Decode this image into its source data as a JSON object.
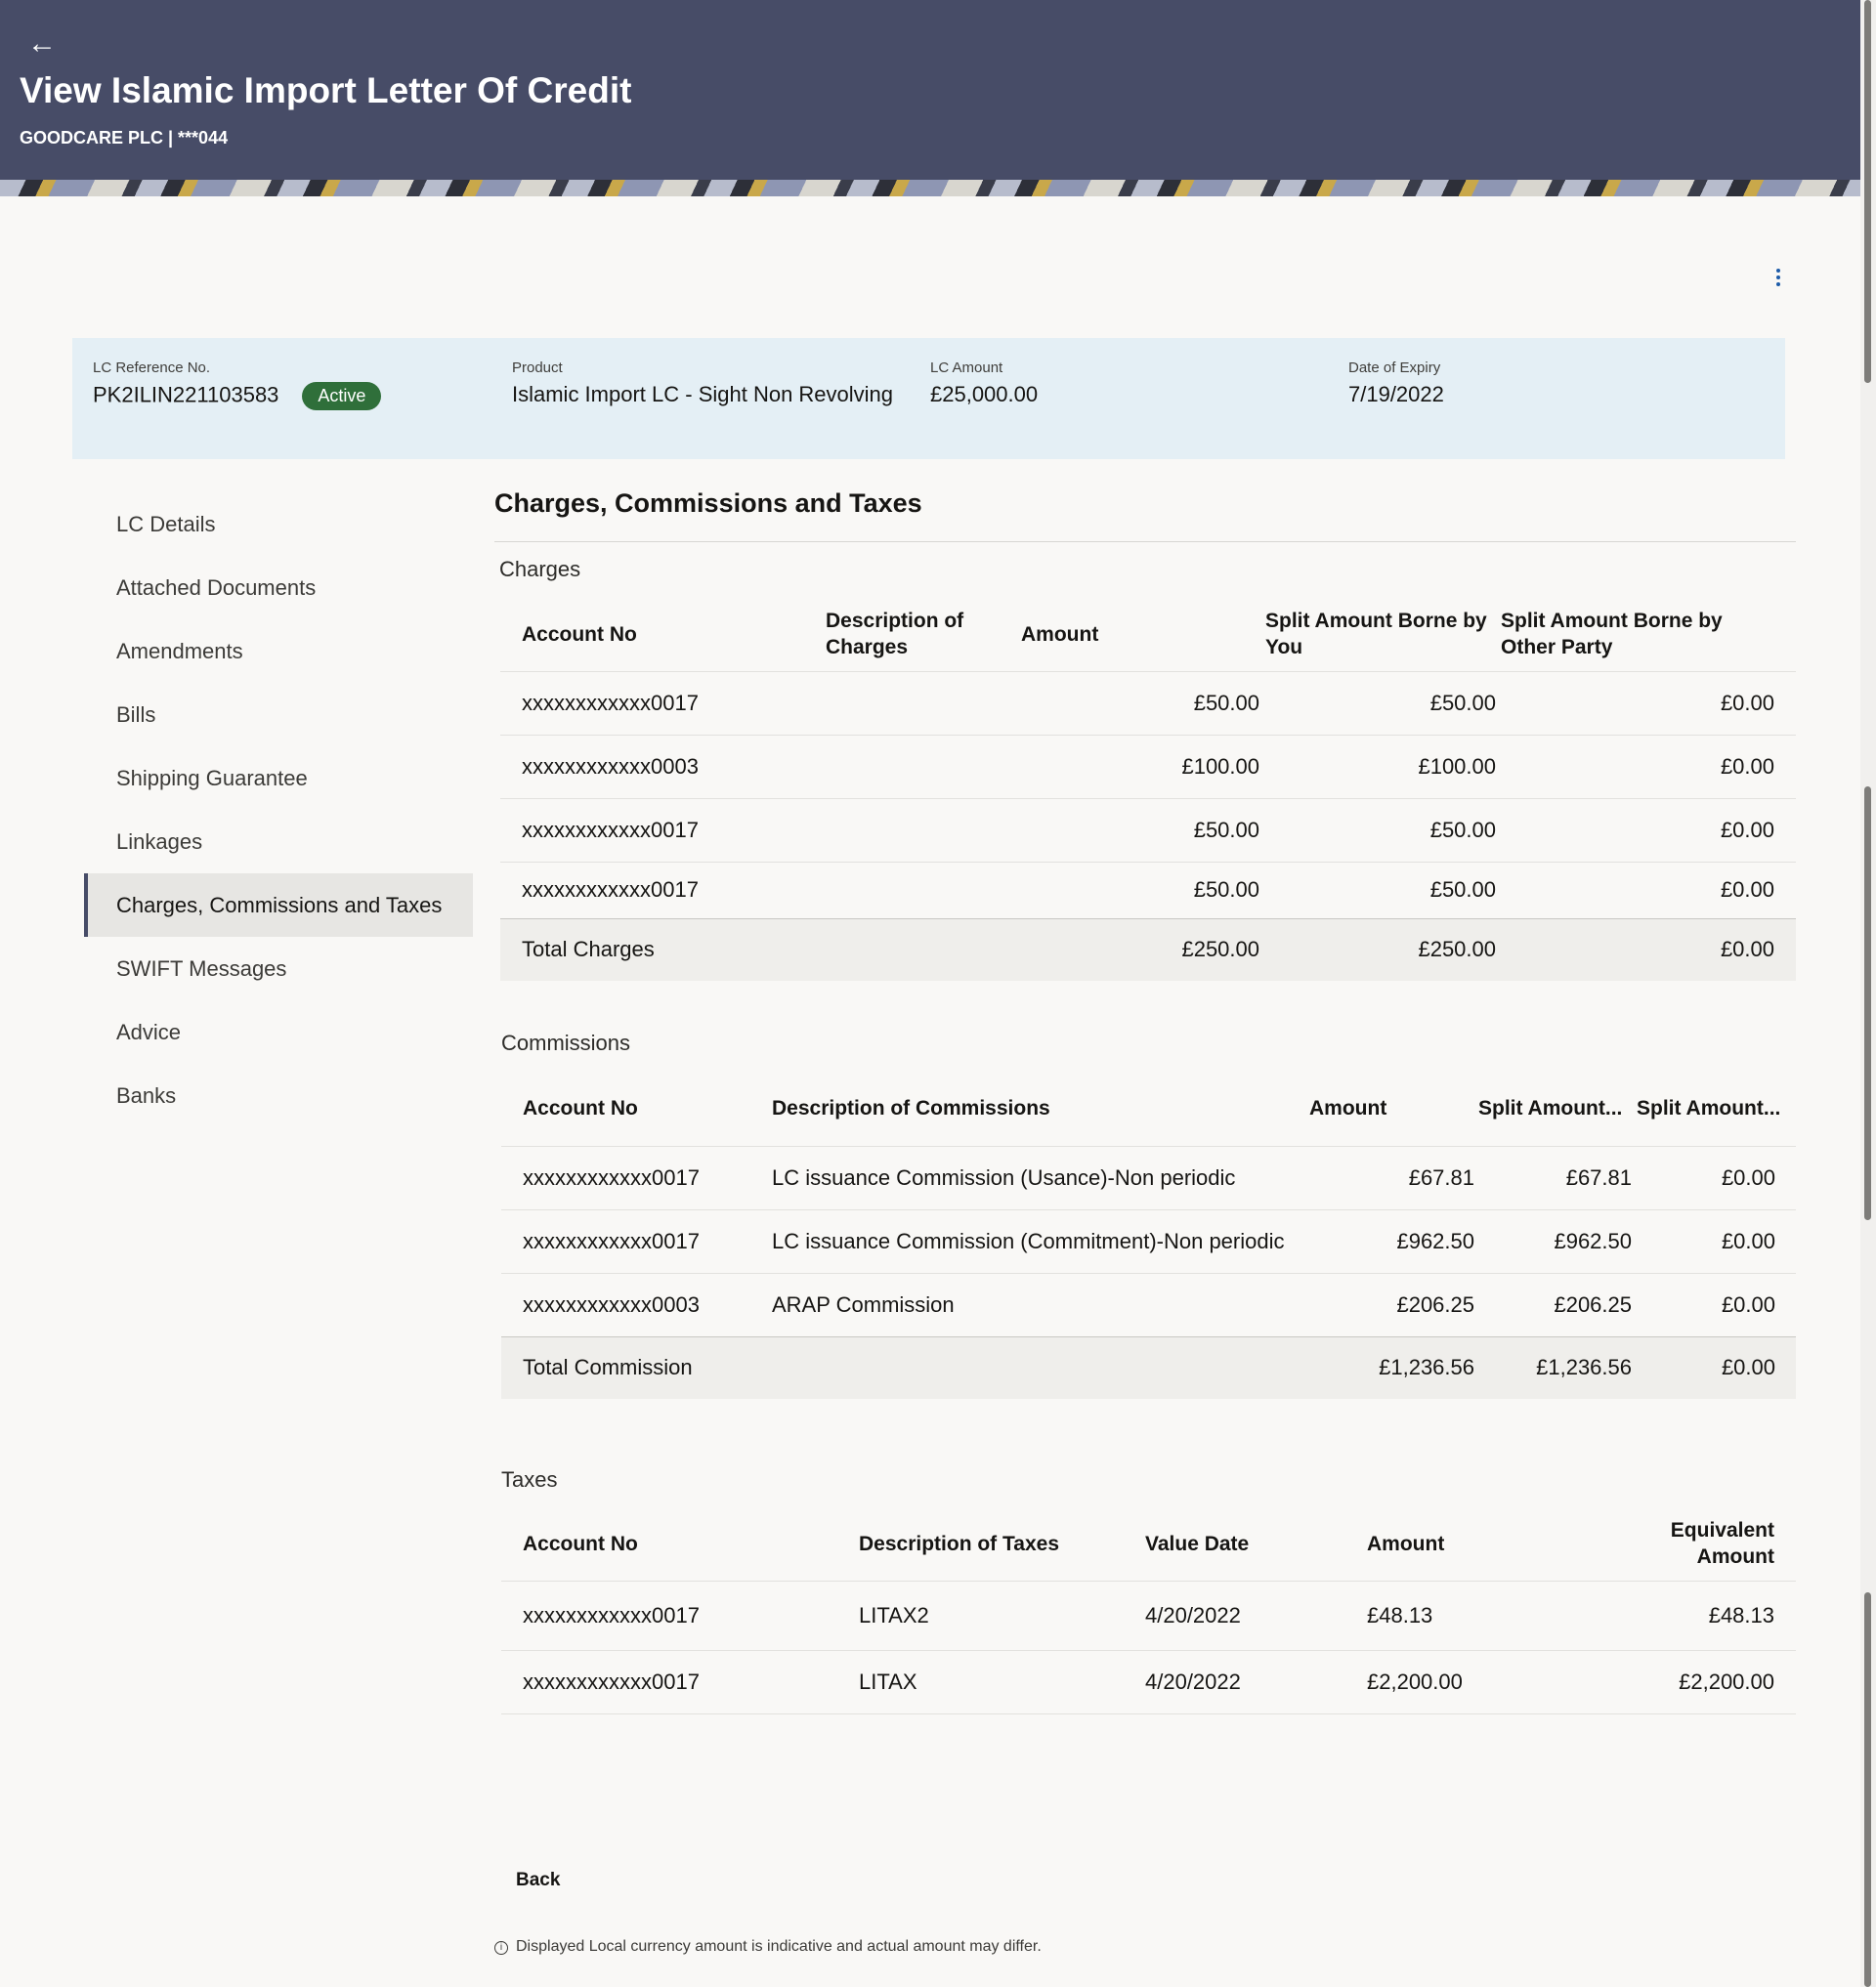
{
  "header": {
    "title": "View Islamic Import Letter Of Credit",
    "subtitle": "GOODCARE PLC | ***044",
    "back_icon": "←"
  },
  "summary": {
    "lc_ref_label": "LC Reference No.",
    "lc_ref_value": "PK2ILIN221103583",
    "status": "Active",
    "product_label": "Product",
    "product_value": "Islamic Import LC - Sight Non Revolving",
    "amount_label": "LC Amount",
    "amount_value": "£25,000.00",
    "expiry_label": "Date of Expiry",
    "expiry_value": "7/19/2022"
  },
  "nav": {
    "items": [
      "LC Details",
      "Attached Documents",
      "Amendments",
      "Bills",
      "Shipping Guarantee",
      "Linkages",
      "Charges, Commissions and Taxes",
      "SWIFT Messages",
      "Advice",
      "Banks"
    ],
    "active": "Charges, Commissions and Taxes"
  },
  "main": {
    "title": "Charges, Commissions and Taxes",
    "charges": {
      "title": "Charges",
      "headers": [
        "Account No",
        "Description of Charges",
        "Amount",
        "Split Amount Borne by You",
        "Split Amount Borne by Other Party"
      ],
      "rows": [
        [
          "xxxxxxxxxxxx0017",
          "",
          "£50.00",
          "£50.00",
          "£0.00"
        ],
        [
          "xxxxxxxxxxxx0003",
          "",
          "£100.00",
          "£100.00",
          "£0.00"
        ],
        [
          "xxxxxxxxxxxx0017",
          "",
          "£50.00",
          "£50.00",
          "£0.00"
        ],
        [
          "xxxxxxxxxxxx0017",
          "",
          "£50.00",
          "£50.00",
          "£0.00"
        ]
      ],
      "total": [
        "Total Charges",
        "",
        "£250.00",
        "£250.00",
        "£0.00"
      ]
    },
    "commissions": {
      "title": "Commissions",
      "headers": [
        "Account No",
        "Description of Commissions",
        "Amount",
        "Split Amount...",
        "Split Amount..."
      ],
      "rows": [
        [
          "xxxxxxxxxxxx0017",
          "LC issuance Commission (Usance)-Non periodic",
          "£67.81",
          "£67.81",
          "£0.00"
        ],
        [
          "xxxxxxxxxxxx0017",
          "LC issuance Commission (Commitment)-Non periodic",
          "£962.50",
          "£962.50",
          "£0.00"
        ],
        [
          "xxxxxxxxxxxx0003",
          "ARAP Commission",
          "£206.25",
          "£206.25",
          "£0.00"
        ]
      ],
      "total": [
        "Total Commission",
        "",
        "£1,236.56",
        "£1,236.56",
        "£0.00"
      ]
    },
    "taxes": {
      "title": "Taxes",
      "headers": [
        "Account No",
        "Description of Taxes",
        "Value Date",
        "Amount",
        "Equivalent Amount"
      ],
      "rows": [
        [
          "xxxxxxxxxxxx0017",
          "LITAX2",
          "4/20/2022",
          "£48.13",
          "£48.13"
        ],
        [
          "xxxxxxxxxxxx0017",
          "LITAX",
          "4/20/2022",
          "£2,200.00",
          "£2,200.00"
        ]
      ]
    }
  },
  "footer": {
    "back_label": "Back",
    "note": "Displayed Local currency amount is indicative and actual amount may differ.",
    "info_icon": "i"
  }
}
